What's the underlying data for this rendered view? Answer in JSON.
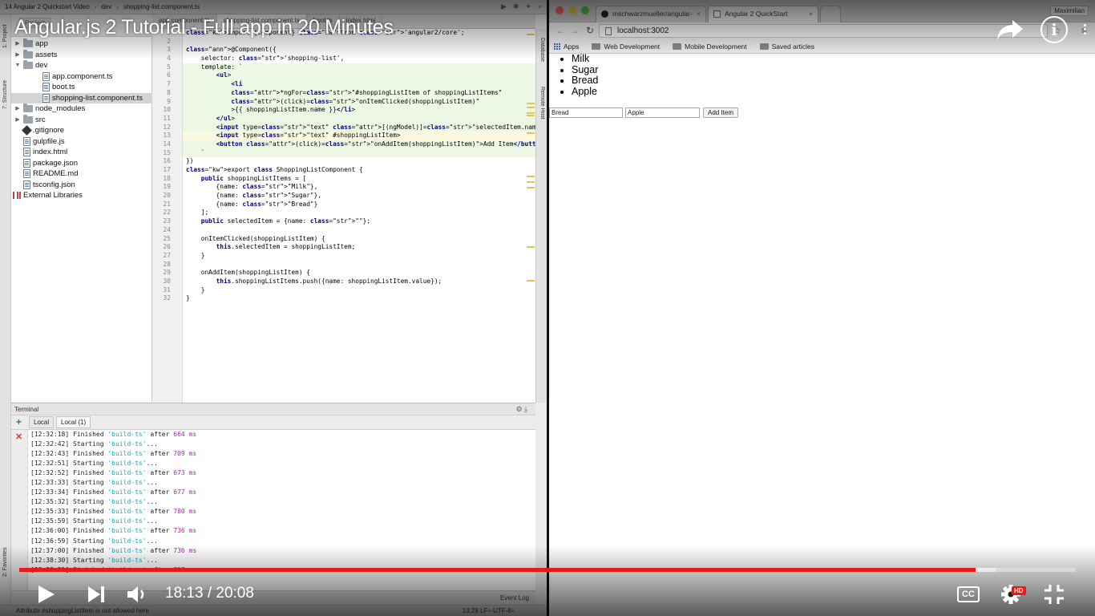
{
  "video": {
    "title": "Angular.js 2 Tutorial - Full app in 20 Minutes",
    "time": "18:13 / 20:08",
    "progress_fraction": 0.9048,
    "buffered_fraction": 0.9245,
    "hd_label": "HD",
    "cc_label": "CC",
    "info_label": "i"
  },
  "ide": {
    "breadcrumb": [
      "14 Angular 2 Quickstart Video",
      "dev",
      "shopping-list.component.ts"
    ],
    "project_tab": "Project",
    "editor_tabs": [
      "app.component.ts",
      "shopping-list.component.ts",
      "boot.ts",
      "index.html"
    ],
    "left_tools": [
      "1: Project",
      "7: Structure",
      "2: Favorites"
    ],
    "right_tools": [
      "Database",
      "Remote Host"
    ],
    "tree": [
      {
        "label": "app",
        "type": "folder",
        "depth": 0,
        "arrow": "▶"
      },
      {
        "label": "assets",
        "type": "folder",
        "depth": 0,
        "arrow": "▶"
      },
      {
        "label": "dev",
        "type": "folder",
        "depth": 0,
        "arrow": "▼"
      },
      {
        "label": "app.component.ts",
        "type": "file",
        "depth": 1,
        "arrow": ""
      },
      {
        "label": "boot.ts",
        "type": "file",
        "depth": 1,
        "arrow": ""
      },
      {
        "label": "shopping-list.component.ts",
        "type": "file",
        "depth": 1,
        "arrow": "",
        "selected": true
      },
      {
        "label": "node_modules",
        "type": "folder",
        "depth": 0,
        "arrow": "▶"
      },
      {
        "label": "src",
        "type": "folder",
        "depth": 0,
        "arrow": "▶"
      },
      {
        "label": ".gitignore",
        "type": "git",
        "depth": 0,
        "arrow": ""
      },
      {
        "label": "gulpfile.js",
        "type": "file",
        "depth": 0,
        "arrow": ""
      },
      {
        "label": "index.html",
        "type": "file",
        "depth": 0,
        "arrow": ""
      },
      {
        "label": "package.json",
        "type": "file",
        "depth": 0,
        "arrow": ""
      },
      {
        "label": "README.md",
        "type": "file",
        "depth": 0,
        "arrow": ""
      },
      {
        "label": "tsconfig.json",
        "type": "file",
        "depth": 0,
        "arrow": ""
      },
      {
        "label": "External Libraries",
        "type": "lib",
        "depth": -1,
        "arrow": ""
      }
    ],
    "line_numbers": [
      "1",
      "2",
      "3",
      "4",
      "5",
      "6",
      "7",
      "8",
      "9",
      "10",
      "11",
      "12",
      "13",
      "14",
      "15",
      "16",
      "17",
      "18",
      "19",
      "20",
      "21",
      "22",
      "23",
      "24",
      "25",
      "26",
      "27",
      "28",
      "29",
      "30",
      "31",
      "32"
    ],
    "code_lines": [
      "import {Component} from 'angular2/core';",
      "",
      "@Component({",
      "    selector: 'shopping-list',",
      "    template: `",
      "        <ul>",
      "            <li",
      "            *ngFor=\"#shoppingListItem of shoppingListItems\"",
      "            (click)=\"onItemClicked(shoppingListItem)\"",
      "            >{{ shoppingListItem.name }}</li>",
      "        </ul>",
      "        <input type=\"text\" [(ngModel)]=\"selectedItem.name\">",
      "        <input type=\"text\" #shoppingListItem>",
      "        <button (click)=\"onAddItem(shoppingListItem)\">Add Item</button>",
      "    `",
      "})",
      "export class ShoppingListComponent {",
      "    public shoppingListItems = [",
      "        {name: \"Milk\"},",
      "        {name: \"Sugar\"},",
      "        {name: \"Bread\"}",
      "    ];",
      "    public selectedItem = {name: \"\"};",
      "",
      "    onItemClicked(shoppingListItem) {",
      "        this.selectedItem = shoppingListItem;",
      "    }",
      "",
      "    onAddItem(shoppingListItem) {",
      "        this.shoppingListItems.push({name: shoppingListItem.value});",
      "    }",
      "}"
    ],
    "terminal": {
      "header": "Terminal",
      "tabs": [
        "Local",
        "Local (1)"
      ],
      "lines": [
        {
          "time": "[12:32:18]",
          "verb": "Finished",
          "task": "'build-ts'",
          "tail": " after ",
          "num": "664 ms"
        },
        {
          "time": "[12:32:42]",
          "verb": "Starting",
          "task": "'build-ts'",
          "tail": "...",
          "num": ""
        },
        {
          "time": "[12:32:43]",
          "verb": "Finished",
          "task": "'build-ts'",
          "tail": " after ",
          "num": "709 ms"
        },
        {
          "time": "[12:32:51]",
          "verb": "Starting",
          "task": "'build-ts'",
          "tail": "...",
          "num": ""
        },
        {
          "time": "[12:32:52]",
          "verb": "Finished",
          "task": "'build-ts'",
          "tail": " after ",
          "num": "673 ms"
        },
        {
          "time": "[12:33:33]",
          "verb": "Starting",
          "task": "'build-ts'",
          "tail": "...",
          "num": ""
        },
        {
          "time": "[12:33:34]",
          "verb": "Finished",
          "task": "'build-ts'",
          "tail": " after ",
          "num": "677 ms"
        },
        {
          "time": "[12:35:32]",
          "verb": "Starting",
          "task": "'build-ts'",
          "tail": "...",
          "num": ""
        },
        {
          "time": "[12:35:33]",
          "verb": "Finished",
          "task": "'build-ts'",
          "tail": " after ",
          "num": "780 ms"
        },
        {
          "time": "[12:35:59]",
          "verb": "Starting",
          "task": "'build-ts'",
          "tail": "...",
          "num": ""
        },
        {
          "time": "[12:36:00]",
          "verb": "Finished",
          "task": "'build-ts'",
          "tail": " after ",
          "num": "736 ms"
        },
        {
          "time": "[12:36:59]",
          "verb": "Starting",
          "task": "'build-ts'",
          "tail": "...",
          "num": ""
        },
        {
          "time": "[12:37:00]",
          "verb": "Finished",
          "task": "'build-ts'",
          "tail": " after ",
          "num": "736 ms"
        },
        {
          "time": "[12:38:30]",
          "verb": "Starting",
          "task": "'build-ts'",
          "tail": "...",
          "num": ""
        },
        {
          "time": "[12:38:31]",
          "verb": "Finished",
          "task": "'build-ts'",
          "tail": " after ",
          "num": "717 ms"
        }
      ]
    },
    "bottom_tabs": {
      "terminal": "Terminal",
      "todo": "6: TODO",
      "event_log": "Event Log"
    },
    "status": {
      "message": "Attribute #shoppingListItem is not allowed here",
      "position": "13:28  LF÷  UTF-8÷"
    }
  },
  "browser": {
    "tabs": [
      "mschwarzmueller/angular-",
      "Angular 2 QuickStart"
    ],
    "user": "Maximilian",
    "url": "localhost:3002",
    "bookmarks": [
      "Apps",
      "Web Development",
      "Mobile Development",
      "Saved articles"
    ],
    "list_items": [
      "Milk",
      "Sugar",
      "Bread",
      "Apple"
    ],
    "input_selected_value": "Bread",
    "input_new_value": "Apple",
    "add_button": "Add Item"
  },
  "colors": {
    "progress_red": "#e51b1b",
    "keyword": "#000080",
    "string": "#008000",
    "task_teal": "#1aa6b7",
    "number_purple": "#a030a0"
  }
}
